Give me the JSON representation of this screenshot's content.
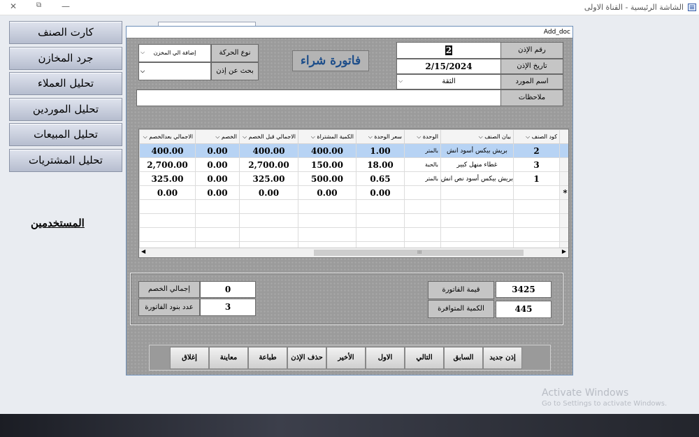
{
  "window": {
    "title": "الشاشة الرئيسية - القناة الاولى",
    "close_glyph": "✕",
    "restore_glyph": "⧉",
    "minimize_glyph": "—"
  },
  "menu": {
    "items": [
      "كارت الصنف",
      "جرد المخازن",
      "تحليل العملاء",
      "تحليل الموردين",
      "تحليل المبيعات",
      "تحليل المشتريات"
    ],
    "users_link": "المستخدمين"
  },
  "form": {
    "caption": "Add_doc",
    "invoice_title": "فاتورة شراء",
    "permit_no_label": "رقم الإذن",
    "permit_no_value": "2",
    "permit_date_label": "تاريخ الإذن",
    "permit_date_value": "2/15/2024",
    "supplier_label": "اسم المورد",
    "supplier_value": "الثقة",
    "notes_label": "ملاحظات",
    "notes_value": "",
    "movement_type_label": "نوع الحركة",
    "movement_type_value": "إضافة الي المخزن",
    "search_label": "بحث عن إذن",
    "search_value": ""
  },
  "grid": {
    "columns": [
      "كود الصنف",
      "بيان الصنف",
      "الوحدة",
      "سعر الوحدة",
      "الكمية المشتراة",
      "الاجمالي قبل الخصم",
      "الخصم",
      "الاجمالي بعدالخصم"
    ],
    "rows": [
      {
        "code": "2",
        "desc": "بريش بيكس أسود انش",
        "unit": "بالمتر",
        "price": "1.00",
        "qty": "400.00",
        "gross": "400.00",
        "discount": "0.00",
        "net": "400.00"
      },
      {
        "code": "3",
        "desc": "غطاء منهل كبير",
        "unit": "بالحبة",
        "price": "18.00",
        "qty": "150.00",
        "gross": "2,700.00",
        "discount": "0.00",
        "net": "2,700.00"
      },
      {
        "code": "1",
        "desc": "بريش بيكس أسود نص انش",
        "unit": "بالمتر",
        "price": "0.65",
        "qty": "500.00",
        "gross": "325.00",
        "discount": "0.00",
        "net": "325.00"
      },
      {
        "code": "",
        "desc": "",
        "unit": "",
        "price": "0.00",
        "qty": "0.00",
        "gross": "0.00",
        "discount": "0.00",
        "net": "0.00"
      }
    ],
    "new_row_marker": "*",
    "scroll_mid_glyph": "III"
  },
  "totals": {
    "total_discount_label": "إجمالي الخصم",
    "total_discount_value": "0",
    "line_count_label": "عدد بنود الفاتورة",
    "line_count_value": "3",
    "invoice_value_label": "قيمة الفاتورة",
    "invoice_value_value": "3425",
    "available_qty_label": "الكمية المتوافرة",
    "available_qty_value": "445"
  },
  "buttons": [
    "إذن جديد",
    "السابق",
    "التالي",
    "الاول",
    "الأخير",
    "حذف الإذن",
    "طباعة",
    "معاينة",
    "إغلاق"
  ],
  "watermark": {
    "line1": "Activate Windows",
    "line2": "Go to Settings to activate Windows."
  }
}
